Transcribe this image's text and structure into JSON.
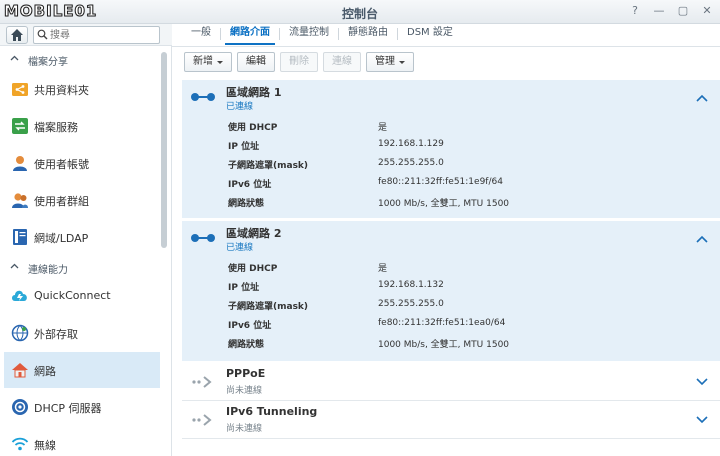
{
  "window": {
    "watermark": "MOBILE01",
    "title": "控制台",
    "buttons": [
      "?",
      "—",
      "▢",
      "✕"
    ]
  },
  "sidebar": {
    "search_placeholder": "搜尋",
    "sections": [
      {
        "label": "檔案分享"
      },
      {
        "label": "連線能力"
      }
    ],
    "items": [
      {
        "label": "共用資料夾",
        "icon": "shared-folder-icon",
        "color": "#f0a428"
      },
      {
        "label": "檔案服務",
        "icon": "file-services-icon",
        "color": "#3aa04a"
      },
      {
        "label": "使用者帳號",
        "icon": "user-icon",
        "color": "#e48c3c"
      },
      {
        "label": "使用者群組",
        "icon": "user-group-icon",
        "color": "#e48c3c"
      },
      {
        "label": "網域/LDAP",
        "icon": "domain-ldap-icon",
        "color": "#2a66b0"
      },
      {
        "label": "QuickConnect",
        "icon": "quickconnect-icon",
        "color": "#2ba9d8"
      },
      {
        "label": "外部存取",
        "icon": "external-access-icon",
        "color": "#2a66b0"
      },
      {
        "label": "網路",
        "icon": "network-icon",
        "color": "#e05a3c"
      },
      {
        "label": "DHCP 伺服器",
        "icon": "dhcp-server-icon",
        "color": "#2a66b0"
      },
      {
        "label": "無線",
        "icon": "wireless-icon",
        "color": "#1aa0d8"
      }
    ],
    "active_item": "網路"
  },
  "tabs": [
    "一般",
    "網路介面",
    "流量控制",
    "靜態路由",
    "DSM 設定"
  ],
  "active_tab": "網路介面",
  "toolbar": {
    "create": "新增",
    "edit": "編輯",
    "delete": "刪除",
    "connect": "連線",
    "manage": "管理"
  },
  "interfaces": [
    {
      "name": "區域網路 1",
      "status": "已連線",
      "expanded": true,
      "details": [
        {
          "k": "使用 DHCP",
          "v": "是"
        },
        {
          "k": "IP 位址",
          "v": "192.168.1.129"
        },
        {
          "k": "子網路遮罩(mask)",
          "v": "255.255.255.0"
        },
        {
          "k": "IPv6 位址",
          "v": "fe80::211:32ff:fe51:1e9f/64"
        },
        {
          "k": "網路狀態",
          "v": "1000 Mb/s, 全雙工, MTU 1500"
        }
      ]
    },
    {
      "name": "區域網路 2",
      "status": "已連線",
      "expanded": true,
      "details": [
        {
          "k": "使用 DHCP",
          "v": "是"
        },
        {
          "k": "IP 位址",
          "v": "192.168.1.132"
        },
        {
          "k": "子網路遮罩(mask)",
          "v": "255.255.255.0"
        },
        {
          "k": "IPv6 位址",
          "v": "fe80::211:32ff:fe51:1ea0/64"
        },
        {
          "k": "網路狀態",
          "v": "1000 Mb/s, 全雙工, MTU 1500"
        }
      ]
    },
    {
      "name": "PPPoE",
      "status": "尚未連線",
      "expanded": false
    },
    {
      "name": "IPv6 Tunneling",
      "status": "尚未連線",
      "expanded": false
    }
  ],
  "colors": {
    "accent": "#0e72c4",
    "panel_bg": "#e5f0f9",
    "active_bg": "#d9eaf7"
  }
}
